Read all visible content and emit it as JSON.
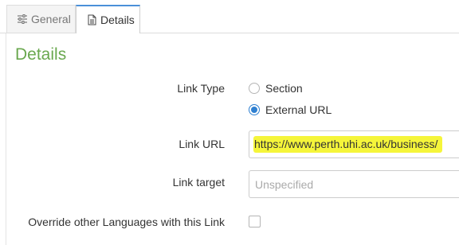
{
  "tabs": [
    {
      "label": "General",
      "icon": "sliders-icon",
      "active": false
    },
    {
      "label": "Details",
      "icon": "document-icon",
      "active": true
    }
  ],
  "page_title": "Details",
  "form": {
    "link_type": {
      "label": "Link Type",
      "options": [
        {
          "label": "Section",
          "checked": false
        },
        {
          "label": "External URL",
          "checked": true
        }
      ]
    },
    "link_url": {
      "label": "Link URL",
      "value": "https://www.perth.uhi.ac.uk/business/",
      "highlight_color": "#f5f53a"
    },
    "link_target": {
      "label": "Link target",
      "placeholder": "Unspecified"
    },
    "override_languages": {
      "label": "Override other Languages with this Link",
      "checked": false
    }
  },
  "colors": {
    "title_green": "#6aa84f",
    "accent_blue": "#2f80d1",
    "tab_active_border": "#4a90d9"
  }
}
